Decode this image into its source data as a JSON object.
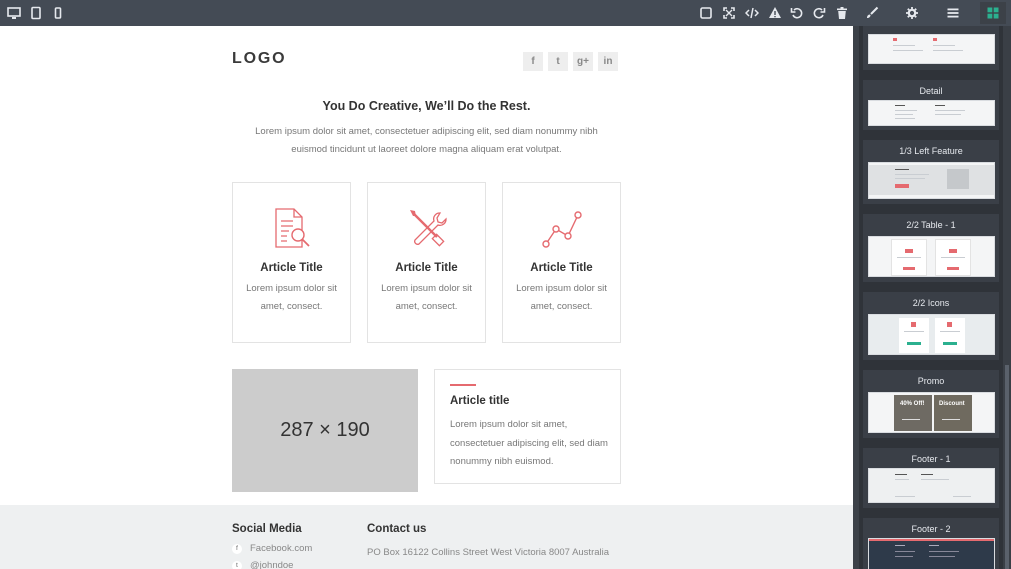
{
  "toolbar": {
    "left": [
      "desktop-icon",
      "tablet-icon",
      "mobile-icon"
    ],
    "right": [
      "square-icon",
      "fullscreen-icon",
      "code-icon",
      "warning-icon",
      "undo-icon",
      "redo-icon",
      "trash-icon"
    ],
    "panels": [
      "brush-icon",
      "gear-icon",
      "layers-icon",
      "blocks-icon"
    ]
  },
  "canvas": {
    "logo": "LOGO",
    "social": [
      "f",
      "t",
      "g+",
      "in"
    ],
    "hero_title": "You Do Creative, We’ll Do the Rest.",
    "hero_text": "Lorem ipsum dolor sit amet, consectetuer adipiscing elit, sed diam nonummy nibh euismod tincidunt ut laoreet dolore magna aliquam erat volutpat.",
    "cards": [
      {
        "title": "Article Title",
        "text": "Lorem ipsum dolor sit amet, consect.",
        "icon": "document-search-icon"
      },
      {
        "title": "Article Title",
        "text": "Lorem ipsum dolor sit amet, consect.",
        "icon": "tools-icon"
      },
      {
        "title": "Article Title",
        "text": "Lorem ipsum dolor sit amet, consect.",
        "icon": "line-chart-icon"
      }
    ],
    "placeholder": "287 × 190",
    "article": {
      "title": "Article title",
      "text": "Lorem ipsum dolor sit amet, consectetuer adipiscing elit, sed diam nonummy nibh euismod."
    },
    "footer": {
      "social_heading": "Social Media",
      "social_links": [
        {
          "icon": "facebook-icon",
          "label": "Facebook.com"
        },
        {
          "icon": "twitter-icon",
          "label": "@johndoe"
        }
      ],
      "contact_heading": "Contact us",
      "contact_address": "PO Box 16122 Collins Street West Victoria 8007 Australia"
    }
  },
  "sidebar": {
    "blocks": [
      "Detail",
      "1/3 Left Feature",
      "2/2 Table - 1",
      "2/2 Icons",
      "Promo",
      "Footer - 1",
      "Footer - 2"
    ]
  },
  "colors": {
    "accent": "#e56a6f",
    "toolbar": "#444b55",
    "sidebar": "#2f3339",
    "active_panel": "#2bb08f"
  }
}
